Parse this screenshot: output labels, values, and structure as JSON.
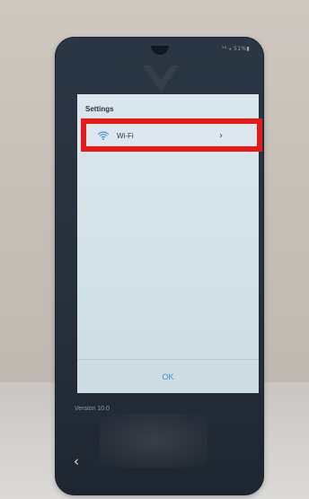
{
  "status_bar": {
    "icons_text": "⁵⁶ ⁎ 51%▮"
  },
  "dialog": {
    "title": "Settings",
    "items": [
      {
        "label": "Wi-Fi",
        "icon": "wifi-icon",
        "trailing": "›"
      }
    ],
    "ok_label": "OK"
  },
  "version_text": "Version 10.0",
  "navigation": {
    "back_label": "‹"
  },
  "colors": {
    "highlight": "#e31b1b",
    "ok_text": "#3f8fd8",
    "dialog_bg": "#d2e0e8",
    "phone_bg": "#28313e"
  }
}
